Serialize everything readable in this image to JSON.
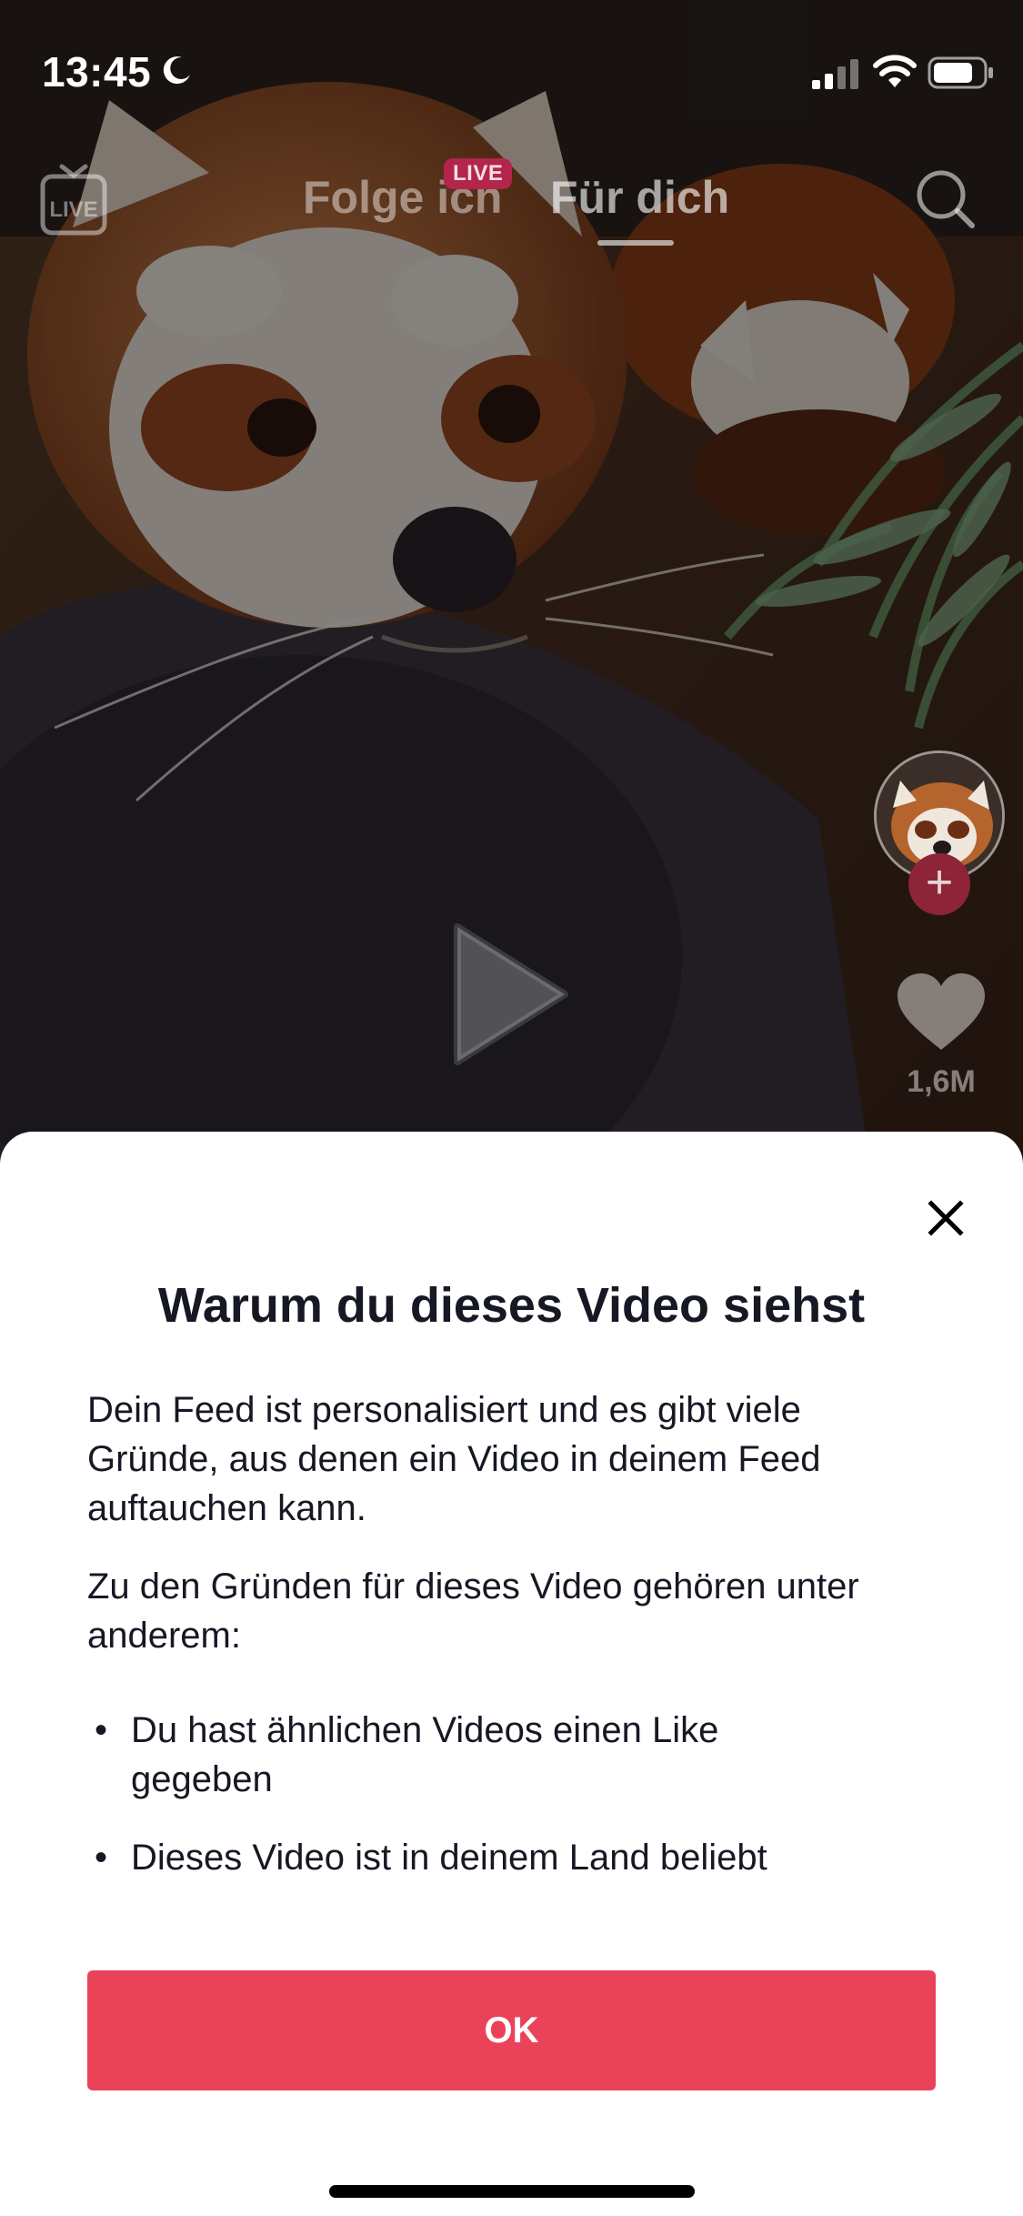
{
  "status_bar": {
    "time": "13:45",
    "icons": [
      "moon-icon",
      "signal-icon",
      "wifi-icon",
      "battery-icon"
    ]
  },
  "top_nav": {
    "live_icon_label": "LIVE",
    "tabs": [
      {
        "label": "Folge ich",
        "selected": false
      },
      {
        "label": "Für dich",
        "selected": true
      }
    ],
    "live_badge": "LIVE",
    "search_icon": "search-icon"
  },
  "video": {
    "subject": "red panda",
    "like_count": "1,6M",
    "paused": true
  },
  "sheet": {
    "title": "Warum du dieses Video siehst",
    "paragraph_1": "Dein Feed ist personalisiert und es gibt viele Gründe, aus denen ein Video in deinem Feed auftauchen kann.",
    "paragraph_2": "Zu den Gründen für dieses Video gehören unter anderem:",
    "reasons": [
      "Du hast ähnlichen Videos einen Like gegeben",
      "Dieses Video ist in deinem Land beliebt"
    ],
    "bullet": "•",
    "ok_label": "OK",
    "close_icon": "close-icon"
  },
  "colors": {
    "accent": "#ea4359",
    "live_badge": "#b3254a",
    "text": "#161823"
  }
}
